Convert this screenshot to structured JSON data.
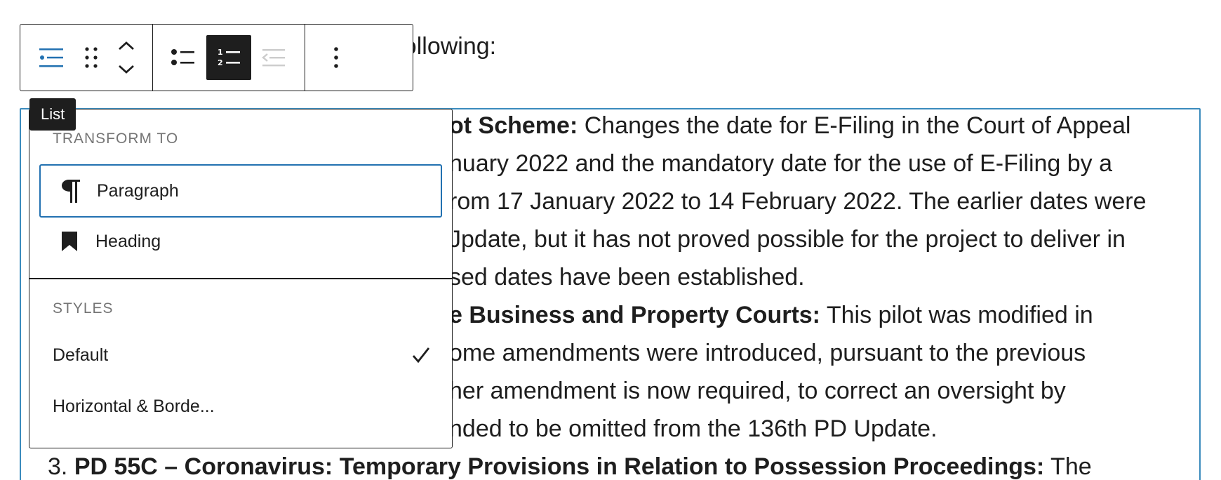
{
  "editor": {
    "intro_fragment": "e following:",
    "list_lines": [
      {
        "bold": "ot Scheme:",
        "text": "  Changes the date for E-Filing in the Court of Appeal"
      },
      {
        "bold": "",
        "text": "nuary 2022 and the mandatory date for the use of E-Filing by a"
      },
      {
        "bold": "",
        "text": "rom 17 January 2022 to 14 February 2022. The earlier dates were"
      },
      {
        "bold": "",
        "text": "Jpdate, but it has not proved possible for the project to deliver in"
      },
      {
        "bold": "",
        "text": "sed dates have been established."
      },
      {
        "bold": "e Business and Property Courts:",
        "text": " This pilot was modified in"
      },
      {
        "bold": "",
        "text": "ome amendments were introduced, pursuant to the previous"
      },
      {
        "bold": "",
        "text": "her amendment is now required, to correct an oversight by"
      },
      {
        "bold": "",
        "text": "nded to be omitted from the 136th PD Update."
      },
      {
        "bold": "PD 55C – Coronavirus: Temporary Provisions in Relation to Possession Proceedings:",
        "text": " The",
        "prefix": "3. "
      }
    ]
  },
  "toolbar": {
    "buttons": [
      {
        "name": "list-block-icon",
        "icon": "list-block-icon"
      },
      {
        "name": "drag-handle",
        "icon": "drag-handle-icon"
      },
      {
        "name": "move-up-down",
        "icon": "chevron-up-down-icon"
      },
      {
        "name": "unordered-list",
        "icon": "unordered-list-icon"
      },
      {
        "name": "ordered-list",
        "icon": "ordered-list-icon",
        "active": true
      },
      {
        "name": "outdent",
        "icon": "outdent-icon",
        "disabled": true
      },
      {
        "name": "more-options",
        "icon": "more-vertical-icon"
      }
    ]
  },
  "tooltip": {
    "label": "List"
  },
  "dropdown": {
    "transform_title": "TRANSFORM TO",
    "transform_items": [
      {
        "label": "Paragraph",
        "icon": "paragraph-icon"
      },
      {
        "label": "Heading",
        "icon": "bookmark-icon"
      }
    ],
    "styles_title": "STYLES",
    "style_items": [
      {
        "label": "Default",
        "selected": true
      },
      {
        "label": "Horizontal & Borde...",
        "selected": false
      }
    ]
  },
  "colors": {
    "accent": "#2271b1",
    "block_border": "#3a8bbd",
    "text": "#1e1e1e",
    "muted": "#757575",
    "disabled": "#cccccc"
  }
}
